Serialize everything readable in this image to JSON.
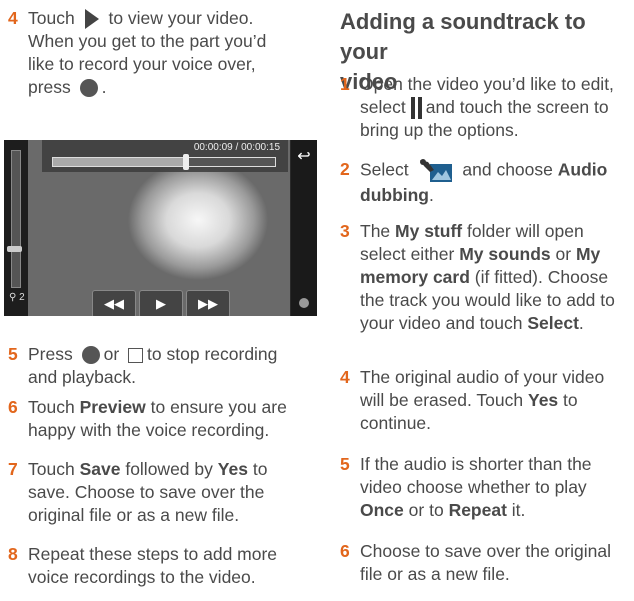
{
  "left": {
    "step4": {
      "num": "4",
      "a": "Touch",
      "b": "to view your video.",
      "c": "When you get to the part you’d",
      "d": "like to record your voice over,",
      "e": "press",
      "f": "."
    },
    "video": {
      "time": "00:00:09  / 00:00:15",
      "level_label": "2",
      "progress": 0.6,
      "rewind": "◀◀",
      "play": "▶",
      "forward": "▶▶",
      "back": "↩"
    },
    "step5": {
      "num": "5",
      "a": "Press",
      "b": "or",
      "c": "to stop recording",
      "d": "and playback."
    },
    "step6": {
      "num": "6",
      "a": "Touch",
      "b": "Preview",
      "c": "to ensure you are",
      "d": "happy with the voice recording."
    },
    "step7": {
      "num": "7",
      "a": "Touch",
      "b": "Save",
      "c": "followed by",
      "d": "Yes",
      "e": "to",
      "f": "save. Choose to save over the",
      "g": "original file or as a new file."
    },
    "step8": {
      "num": "8",
      "a": "Repeat these steps to add more",
      "b": "voice recordings to the video."
    }
  },
  "right": {
    "heading_line1": "Adding a soundtrack to your",
    "heading_line2": "video",
    "step1": {
      "num": "1",
      "a": "Open the video you’d like to edit,",
      "b": "select",
      "c": "and touch the screen to",
      "d": "bring up the options."
    },
    "step2": {
      "num": "2",
      "a": "Select",
      "b": "and choose",
      "c": "Audio",
      "d": "dubbing",
      "e": "."
    },
    "step3": {
      "num": "3",
      "a": "The",
      "b": "My stuff",
      "c": "folder will open",
      "d": "select either",
      "e": "My sounds",
      "f": "or",
      "g": "My",
      "h": "memory card",
      "i": "(if fitted). Choose",
      "j": "the track you would like to add to",
      "k": "your video and touch",
      "l": "Select",
      "m": "."
    },
    "step4": {
      "num": "4",
      "a": "The original audio of your video",
      "b": "will be erased. Touch",
      "c": "Yes",
      "d": "to",
      "e": "continue."
    },
    "step5": {
      "num": "5",
      "a": "If the audio is shorter than the",
      "b": "video choose whether to play",
      "c": "Once",
      "d": "or to",
      "e": "Repeat",
      "f": "it."
    },
    "step6": {
      "num": "6",
      "a": "Choose to save over the original",
      "b": "file or as a new file."
    }
  }
}
